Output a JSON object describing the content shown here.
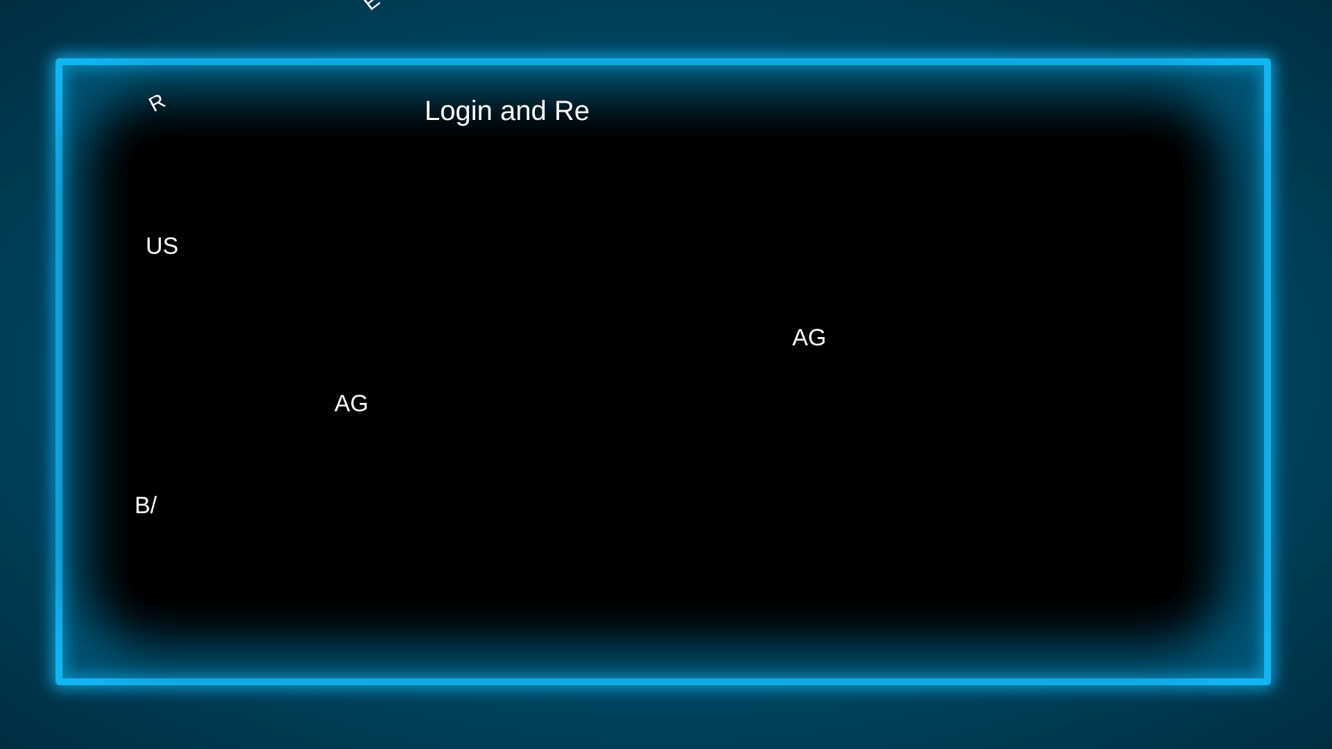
{
  "screen": {
    "title": "Login and Re",
    "top_edge_glyph": "E",
    "corner_glyph": "R",
    "labels": {
      "us": "US",
      "ag_right": "AG",
      "ag_left": "AG",
      "b": "B/"
    }
  },
  "colors": {
    "frame_glow": "#12b4f2",
    "background": "#003a52",
    "panel": "#000000",
    "text": "#ffffff"
  }
}
